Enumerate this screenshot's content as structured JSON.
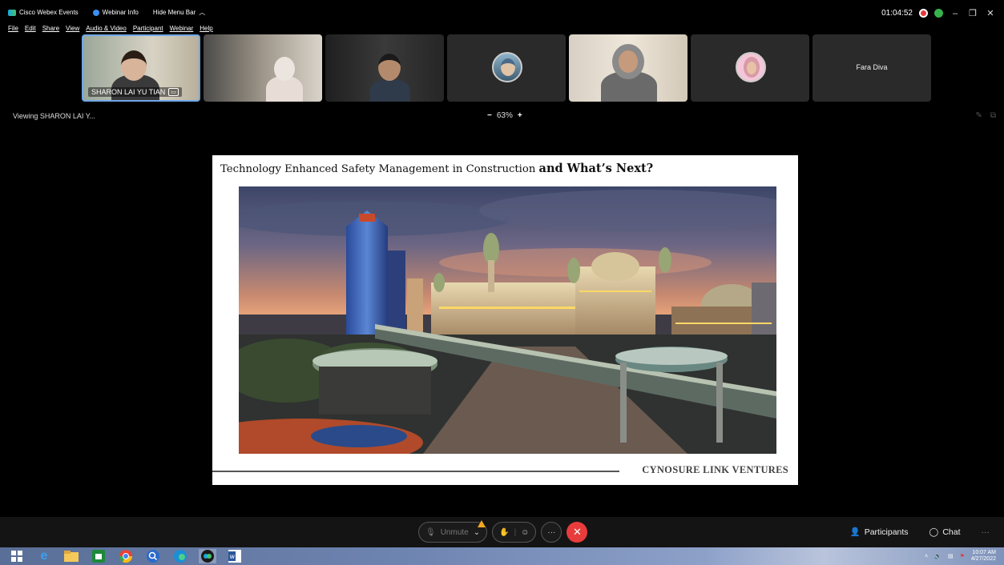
{
  "titlebar": {
    "app_name": "Cisco Webex Events",
    "webinar_info": "Webinar Info",
    "hide_menu": "Hide Menu Bar",
    "timer": "01:04:52"
  },
  "menu": [
    "File",
    "Edit",
    "Share",
    "View",
    "Audio & Video",
    "Participant",
    "Webinar",
    "Help"
  ],
  "participants": [
    {
      "name": "SHARON LAI YU TIAN",
      "active": true
    },
    {
      "name": ""
    },
    {
      "name": ""
    },
    {
      "name": ""
    },
    {
      "name": ""
    },
    {
      "name": ""
    },
    {
      "name": "Fara Diva"
    }
  ],
  "view": {
    "viewing": "Viewing SHARON LAI Y...",
    "zoom_out": "−",
    "zoom": "63%",
    "zoom_in": "+"
  },
  "slide": {
    "title_regular": "Technology Enhanced Safety Management in Construction",
    "title_bold": "and What’s Next?",
    "brand": "CYNOSURE LINK VENTURES"
  },
  "controls": {
    "unmute": "Unmute",
    "participants": "Participants",
    "chat": "Chat",
    "more": "···"
  },
  "taskbar": {
    "time": "10:07 AM",
    "date": "4/27/2022"
  },
  "colors": {
    "end_call": "#e83c3c",
    "active_tile_border": "#6fa8e8",
    "warning": "#f5a623"
  }
}
